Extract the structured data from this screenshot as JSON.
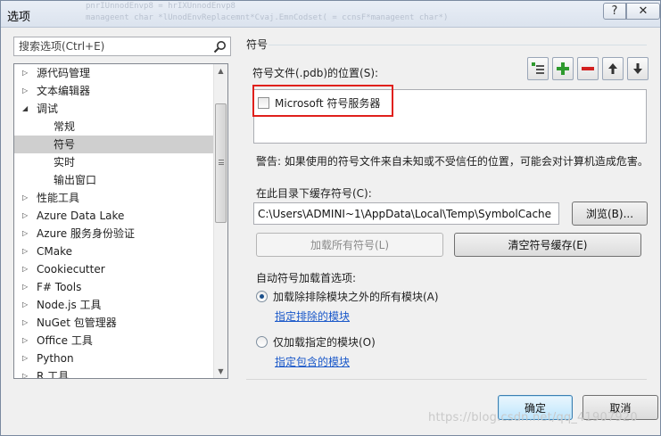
{
  "window": {
    "title": "选项",
    "title_code_lines": [
      "pnrIUnnodEnvp8 = hrIXUnnodEnvp8",
      "manageent char *lUnodEnvReplacemnt*Cvaj.EmnCodset( = ccnsF*manageent char*)"
    ],
    "help_glyph": "?",
    "close_glyph": "✕"
  },
  "search": {
    "placeholder": "搜索选项(Ctrl+E)"
  },
  "tree": {
    "items": [
      {
        "label": "源代码管理",
        "state": "collapsed",
        "level": 0
      },
      {
        "label": "文本编辑器",
        "state": "collapsed",
        "level": 0
      },
      {
        "label": "调试",
        "state": "expanded",
        "level": 0
      },
      {
        "label": "常规",
        "state": "leaf",
        "level": 1
      },
      {
        "label": "符号",
        "state": "leaf",
        "level": 1,
        "selected": true
      },
      {
        "label": "实时",
        "state": "leaf",
        "level": 1
      },
      {
        "label": "输出窗口",
        "state": "leaf",
        "level": 1
      },
      {
        "label": "性能工具",
        "state": "collapsed",
        "level": 0
      },
      {
        "label": "Azure Data Lake",
        "state": "collapsed",
        "level": 0
      },
      {
        "label": "Azure 服务身份验证",
        "state": "collapsed",
        "level": 0
      },
      {
        "label": "CMake",
        "state": "collapsed",
        "level": 0
      },
      {
        "label": "Cookiecutter",
        "state": "collapsed",
        "level": 0
      },
      {
        "label": "F# Tools",
        "state": "collapsed",
        "level": 0
      },
      {
        "label": "Node.js 工具",
        "state": "collapsed",
        "level": 0
      },
      {
        "label": "NuGet 包管理器",
        "state": "collapsed",
        "level": 0
      },
      {
        "label": "Office 工具",
        "state": "collapsed",
        "level": 0
      },
      {
        "label": "Python",
        "state": "collapsed",
        "level": 0
      },
      {
        "label": "R 工具",
        "state": "collapsed",
        "level": 0
      }
    ],
    "scroll_up_glyph": "▲",
    "scroll_down_glyph": "▼"
  },
  "symbols": {
    "section_title": "符号",
    "locations_label": "符号文件(.pdb)的位置(S):",
    "locations": [
      {
        "label": "Microsoft 符号服务器",
        "checked": false
      }
    ],
    "warning": "警告: 如果使用的符号文件来自未知或不受信任的位置，可能会对计算机造成危害。",
    "cache_label": "在此目录下缓存符号(C):",
    "cache_path": "C:\\Users\\ADMINI~1\\AppData\\Local\\Temp\\SymbolCache",
    "browse_button": "浏览(B)...",
    "load_all_button": "加载所有符号(L)",
    "clear_cache_button": "清空符号缓存(E)",
    "preference_label": "自动符号加载首选项:",
    "radio_all_except": "加载除排除模块之外的所有模块(A)",
    "link_excluded": "指定排除的模块",
    "radio_only_specified": "仅加载指定的模块(O)",
    "link_included": "指定包含的模块",
    "selected_radio": "all_except"
  },
  "footer": {
    "ok_button": "确定",
    "cancel_button": "取消",
    "watermark": "https://blog.csdn.net/qq_41907920"
  },
  "colors": {
    "highlight_border": "#e0201c",
    "add_green": "#2e9a2e",
    "remove_red": "#d32020",
    "link_blue": "#1a58c9"
  }
}
